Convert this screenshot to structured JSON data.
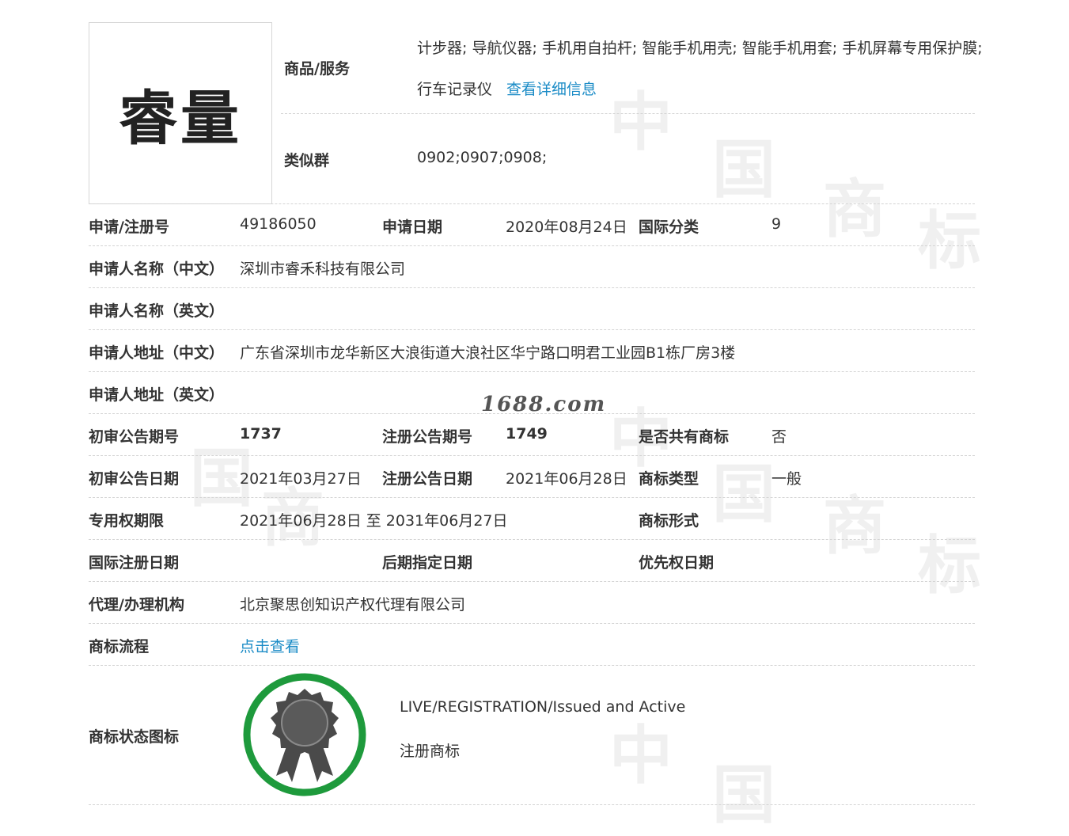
{
  "logo": {
    "text": "睿量"
  },
  "goods": {
    "label": "商品/服务",
    "items_line1": "计步器; 导航仪器; 手机用自拍杆; 智能手机用壳; 智能手机用套; 手机屏幕专用保护膜;",
    "items_line2": "行车记录仪",
    "detail_link": "查看详细信息"
  },
  "similar_group": {
    "label": "类似群",
    "value": "0902;0907;0908;"
  },
  "rows": {
    "reg_no": {
      "label": "申请/注册号",
      "value": "49186050"
    },
    "apply_date": {
      "label": "申请日期",
      "value": "2020年08月24日"
    },
    "intl_class": {
      "label": "国际分类",
      "value": "9"
    },
    "applicant_cn": {
      "label": "申请人名称（中文）",
      "value": "深圳市睿禾科技有限公司"
    },
    "applicant_en": {
      "label": "申请人名称（英文）",
      "value": ""
    },
    "address_cn": {
      "label": "申请人地址（中文）",
      "value": "广东省深圳市龙华新区大浪街道大浪社区华宁路口明君工业园B1栋厂房3楼"
    },
    "address_en": {
      "label": "申请人地址（英文）",
      "value": ""
    },
    "prelim_issue": {
      "label": "初审公告期号",
      "value": "1737"
    },
    "reg_issue": {
      "label": "注册公告期号",
      "value": "1749"
    },
    "shared": {
      "label": "是否共有商标",
      "value": "否"
    },
    "prelim_date": {
      "label": "初审公告日期",
      "value": "2021年03月27日"
    },
    "reg_date": {
      "label": "注册公告日期",
      "value": "2021年06月28日"
    },
    "tm_type": {
      "label": "商标类型",
      "value": "一般"
    },
    "exclusive": {
      "label": "专用权期限",
      "value": "2021年06月28日 至 2031年06月27日"
    },
    "tm_form": {
      "label": "商标形式",
      "value": ""
    },
    "intl_reg_date": {
      "label": "国际注册日期",
      "value": ""
    },
    "later_date": {
      "label": "后期指定日期",
      "value": ""
    },
    "priority_date": {
      "label": "优先权日期",
      "value": ""
    },
    "agency": {
      "label": "代理/办理机构",
      "value": "北京聚思创知识产权代理有限公司"
    },
    "process": {
      "label": "商标流程",
      "value": "点击查看"
    }
  },
  "status": {
    "label": "商标状态图标",
    "en": "LIVE/REGISTRATION/Issued and Active",
    "cn": "注册商标"
  },
  "watermark": {
    "site": "1688.com"
  },
  "colors": {
    "link": "#1a8bc6",
    "badge_ring": "#1e9a3c",
    "badge_seal": "#4a4a4a"
  }
}
